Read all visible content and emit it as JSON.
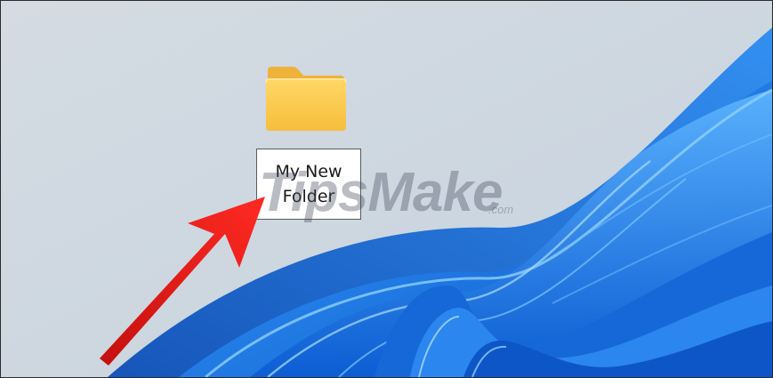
{
  "desktop": {
    "folder": {
      "icon": "folder-icon",
      "name_line1": "My New",
      "name_line2": "Folder"
    }
  },
  "watermark": {
    "text": "TipsMake",
    "suffix": ".com"
  },
  "annotation": {
    "icon": "red-arrow-icon"
  },
  "colors": {
    "folder_body": "#F9C94A",
    "folder_tab": "#F2B63A",
    "wallpaper_bg": "#D6DEE6",
    "wallpaper_blue": "#1E7BE5",
    "arrow": "#E8201E"
  }
}
